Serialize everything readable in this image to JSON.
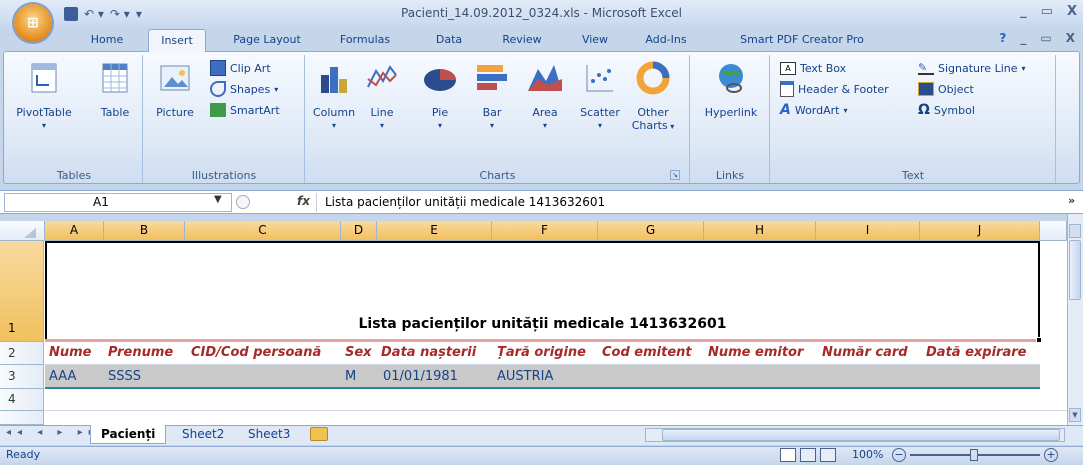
{
  "window": {
    "title": "Pacienti_14.09.2012_0324.xls - Microsoft Excel",
    "controls": [
      "_",
      "▭",
      "X"
    ],
    "ribbon_controls": [
      "?",
      "_",
      "▭",
      "X"
    ]
  },
  "ribbon_tabs": [
    "Home",
    "Insert",
    "Page Layout",
    "Formulas",
    "Data",
    "Review",
    "View",
    "Add-Ins",
    "Smart PDF Creator Pro"
  ],
  "active_tab": "Insert",
  "groups": {
    "tables": {
      "label": "Tables",
      "pivot": "PivotTable",
      "table": "Table"
    },
    "illustrations": {
      "label": "Illustrations",
      "picture": "Picture",
      "clipart": "Clip Art",
      "shapes": "Shapes",
      "smartart": "SmartArt"
    },
    "charts": {
      "label": "Charts",
      "column": "Column",
      "line": "Line",
      "pie": "Pie",
      "bar": "Bar",
      "area": "Area",
      "scatter": "Scatter",
      "other1": "Other",
      "other2": "Charts"
    },
    "links": {
      "label": "Links",
      "hyperlink": "Hyperlink"
    },
    "text": {
      "label": "Text",
      "textbox": "Text Box",
      "header_footer": "Header & Footer",
      "wordart": "WordArt",
      "signature": "Signature Line",
      "object": "Object",
      "symbol": "Symbol"
    }
  },
  "formula_bar": {
    "name_box": "A1",
    "fx": "fx",
    "content": "Lista pacienților unității medicale 1413632601"
  },
  "columns": [
    "A",
    "B",
    "C",
    "D",
    "E",
    "F",
    "G",
    "H",
    "I",
    "J"
  ],
  "rows": [
    "1",
    "2",
    "3",
    "4"
  ],
  "sheet": {
    "title": "Lista pacienților unității medicale 1413632601",
    "headers": [
      "Nume",
      "Prenume",
      "CID/Cod persoană",
      "Sex",
      "Data nașterii",
      "Țară origine",
      "Cod emitent",
      "Nume emitor",
      "Număr card",
      "Dată expirare"
    ],
    "row3": [
      "AAA",
      "SSSS",
      "",
      "M",
      "01/01/1981",
      "AUSTRIA",
      "",
      "",
      "",
      ""
    ]
  },
  "sheet_tabs": [
    "Pacienți",
    "Sheet2",
    "Sheet3"
  ],
  "active_sheet": "Pacienți",
  "status": {
    "mode": "Ready",
    "zoom": "100%"
  }
}
